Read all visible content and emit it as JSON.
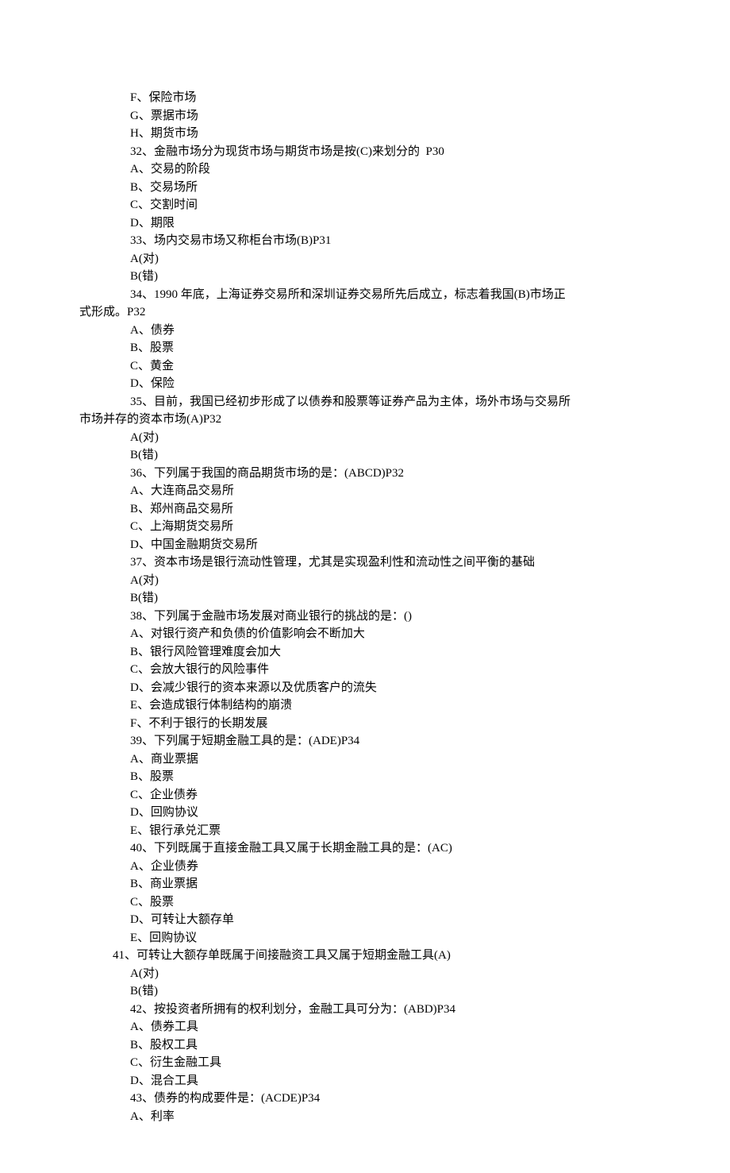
{
  "lines": [
    {
      "cls": "indent",
      "text": "F、保险市场"
    },
    {
      "cls": "indent",
      "text": "G、票据市场"
    },
    {
      "cls": "indent",
      "text": "H、期货市场"
    },
    {
      "cls": "indent",
      "text": "32、金融市场分为现货市场与期货市场是按(C)来划分的  P30"
    },
    {
      "cls": "indent",
      "text": "A、交易的阶段"
    },
    {
      "cls": "indent",
      "text": "B、交易场所"
    },
    {
      "cls": "indent",
      "text": "C、交割时间"
    },
    {
      "cls": "indent",
      "text": "D、期限"
    },
    {
      "cls": "indent",
      "text": "33、场内交易市场又称柜台市场(B)P31"
    },
    {
      "cls": "indent",
      "text": "A(对)"
    },
    {
      "cls": "indent",
      "text": "B(错)"
    },
    {
      "cls": "indent",
      "text": "34、1990 年底，上海证券交易所和深圳证券交易所先后成立，标志着我国(B)市场正"
    },
    {
      "cls": "noindent",
      "text": "式形成。P32"
    },
    {
      "cls": "indent",
      "text": "A、债券"
    },
    {
      "cls": "indent",
      "text": "B、股票"
    },
    {
      "cls": "indent",
      "text": "C、黄金"
    },
    {
      "cls": "indent",
      "text": "D、保险"
    },
    {
      "cls": "indent",
      "text": "35、目前，我国已经初步形成了以债券和股票等证券产品为主体，场外市场与交易所"
    },
    {
      "cls": "noindent",
      "text": "市场并存的资本市场(A)P32"
    },
    {
      "cls": "indent",
      "text": "A(对)"
    },
    {
      "cls": "indent",
      "text": "B(错)"
    },
    {
      "cls": "indent",
      "text": "36、下列属于我国的商品期货市场的是：(ABCD)P32"
    },
    {
      "cls": "indent",
      "text": "A、大连商品交易所"
    },
    {
      "cls": "indent",
      "text": "B、郑州商品交易所"
    },
    {
      "cls": "indent",
      "text": "C、上海期货交易所"
    },
    {
      "cls": "indent",
      "text": "D、中国金融期货交易所"
    },
    {
      "cls": "indent",
      "text": "37、资本市场是银行流动性管理，尤其是实现盈利性和流动性之间平衡的基础"
    },
    {
      "cls": "indent",
      "text": "A(对)"
    },
    {
      "cls": "indent",
      "text": "B(错)"
    },
    {
      "cls": "indent",
      "text": "38、下列属于金融市场发展对商业银行的挑战的是：()"
    },
    {
      "cls": "indent",
      "text": "A、对银行资产和负债的价值影响会不断加大"
    },
    {
      "cls": "indent",
      "text": "B、银行风险管理难度会加大"
    },
    {
      "cls": "indent",
      "text": "C、会放大银行的风险事件"
    },
    {
      "cls": "indent",
      "text": "D、会减少银行的资本来源以及优质客户的流失"
    },
    {
      "cls": "indent",
      "text": "E、会造成银行体制结构的崩溃"
    },
    {
      "cls": "indent",
      "text": "F、不利于银行的长期发展"
    },
    {
      "cls": "indent",
      "text": "39、下列属于短期金融工具的是：(ADE)P34"
    },
    {
      "cls": "indent",
      "text": "A、商业票据"
    },
    {
      "cls": "indent",
      "text": "B、股票"
    },
    {
      "cls": "indent",
      "text": "C、企业债券"
    },
    {
      "cls": "indent",
      "text": "D、回购协议"
    },
    {
      "cls": "indent",
      "text": "E、银行承兑汇票"
    },
    {
      "cls": "indent",
      "text": "40、下列既属于直接金融工具又属于长期金融工具的是：(AC)"
    },
    {
      "cls": "indent",
      "text": "A、企业债券"
    },
    {
      "cls": "indent",
      "text": "B、商业票据"
    },
    {
      "cls": "indent",
      "text": "C、股票"
    },
    {
      "cls": "indent",
      "text": "D、可转让大额存单"
    },
    {
      "cls": "indent",
      "text": "E、回购协议"
    },
    {
      "cls": "small-indent",
      "text": "41、可转让大额存单既属于间接融资工具又属于短期金融工具(A)"
    },
    {
      "cls": "indent",
      "text": "A(对)"
    },
    {
      "cls": "indent",
      "text": "B(错)"
    },
    {
      "cls": "indent",
      "text": "42、按投资者所拥有的权利划分，金融工具可分为：(ABD)P34"
    },
    {
      "cls": "indent",
      "text": "A、债券工具"
    },
    {
      "cls": "indent",
      "text": "B、股权工具"
    },
    {
      "cls": "indent",
      "text": "C、衍生金融工具"
    },
    {
      "cls": "indent",
      "text": "D、混合工具"
    },
    {
      "cls": "indent",
      "text": "43、债券的构成要件是：(ACDE)P34"
    },
    {
      "cls": "indent",
      "text": "A、利率"
    }
  ]
}
